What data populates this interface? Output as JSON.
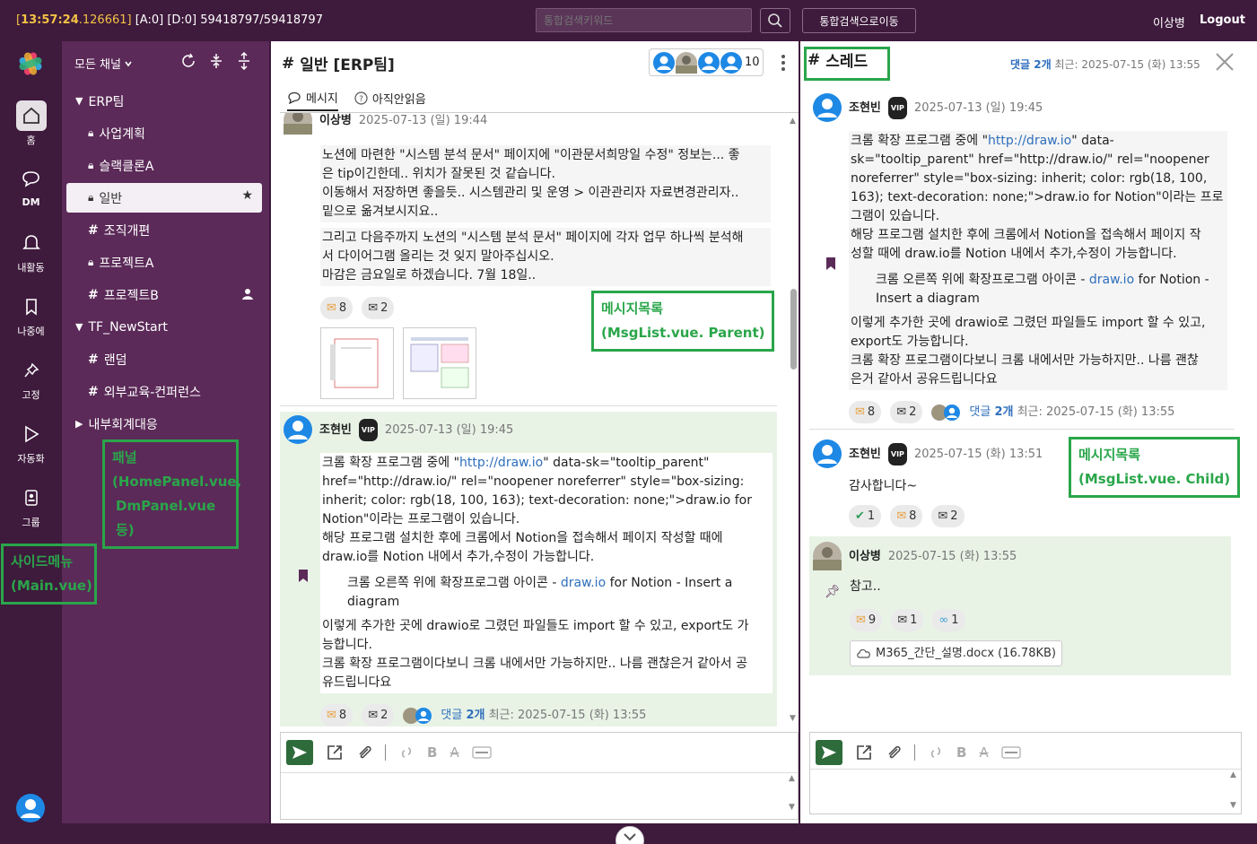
{
  "topbar": {
    "time": "13:57:24",
    "ms": ".126661]",
    "bracket_open": "[",
    "status": " [A:0] [D:0] 59418797/59418797",
    "search_placeholder": "통합검색키워드",
    "move_btn": "통합검색으로이동",
    "user": "이상병",
    "logout": "Logout"
  },
  "sidemenu": {
    "items": [
      {
        "label": "홈",
        "icon": "home-icon"
      },
      {
        "label": "DM",
        "icon": "dm-icon"
      },
      {
        "label": "내활동",
        "icon": "bell-icon"
      },
      {
        "label": "나중에",
        "icon": "bookmark-icon"
      },
      {
        "label": "고정",
        "icon": "pin-icon"
      },
      {
        "label": "자동화",
        "icon": "play-icon"
      },
      {
        "label": "그룹",
        "icon": "group-icon"
      }
    ]
  },
  "panel": {
    "header": "모든 채널",
    "tree": [
      {
        "label": "ERP팀",
        "kind": "group"
      },
      {
        "label": "사업계획",
        "kind": "lock"
      },
      {
        "label": "슬랙클론A",
        "kind": "lock"
      },
      {
        "label": "일반",
        "kind": "lock"
      },
      {
        "label": "조직개편",
        "kind": "hash"
      },
      {
        "label": "프로젝트A",
        "kind": "lock"
      },
      {
        "label": "프로젝트B",
        "kind": "hash"
      },
      {
        "label": "TF_NewStart",
        "kind": "group"
      },
      {
        "label": "랜덤",
        "kind": "hash"
      },
      {
        "label": "외부교육-컨퍼런스",
        "kind": "hash"
      },
      {
        "label": "내부회계대응",
        "kind": "collapsed"
      }
    ]
  },
  "main": {
    "title": "일반 [ERP팀]",
    "member_count": "10",
    "tabs": [
      "메시지",
      "아직안읽음"
    ],
    "msg1": {
      "name": "이상병",
      "date": "2025-07-13 (일) 19:44",
      "lines": [
        "노션에 마련한 \"시스템 분석 문서\" 페이지에 \"이관문서희망일 수정\" 정보는... 좋",
        "은 tip이긴한데.. 위치가 잘못된 것 같습니다.",
        "이동해서 저장하면 좋을듯..  시스템관리 및 운영 > 이관관리자 자료변경관리자..",
        "밑으로 옮겨보시지요..",
        "그리고 다음주까지 노션의 \"시스템 분석 문서\" 페이지에 각자 업무 하나씩 분석해",
        "서 다이어그램 올리는 것 잊지 말아주십시오.",
        "마감은 금요일로 하겠습니다. 7월 18일.."
      ],
      "r1": "8",
      "r2": "2"
    },
    "msg2": {
      "name": "조현빈",
      "vip": "VIP",
      "date": "2025-07-13 (일) 19:45",
      "p1a": "크롬 확장 프로그램 중에 \"",
      "p1link": "http://draw.io",
      "p1b": "\" data-sk=\"tooltip_parent\"",
      "p1c": "href=\"http://draw.io/\" rel=\"noopener noreferrer\" style=\"box-sizing:",
      "p1d": "inherit; color: rgb(18, 100, 163); text-decoration: none;\">draw.io for",
      "p1e": "Notion\"이라는 프로그램이 있습니다.",
      "p2a": "해당 프로그램 설치한 후에 크롬에서 Notion을 접속해서 페이지 작성할 때에",
      "p2b": "draw.io를 Notion 내에서 추가,수정이 가능합니다.",
      "q1a": "크롬 오른쪽 위에 확장프로그램 아이콘 - ",
      "q1link": "draw.io",
      "q1b": " for Notion - Insert a",
      "q1c": "diagram",
      "p3a": "이렇게 추가한 곳에 drawio로 그렸던 파일들도 import 할 수 있고, export도 가",
      "p3b": "능합니다.",
      "p4a": "크롬 확장 프로그램이다보니 크롬 내에서만 가능하지만.. 나름 괜찮은거 같아서 공",
      "p4b": "유드립니다요",
      "r1": "8",
      "r2": "2",
      "reply_pre": "댓글 ",
      "reply_num": "2개",
      "reply_post": " 최근: 2025-07-15 (화) 13:55"
    }
  },
  "labels": {
    "parent1": "메시지목록",
    "parent2": "(MsgList.vue. Parent)",
    "child1": "메시지목록",
    "child2": "(MsgList.vue. Child)",
    "panel1": "패널",
    "panel2": "(HomePanel.vue,",
    "panel3": "DmPanel.vue 등)",
    "side1": "사이드메뉴",
    "side2": "(Main.vue)"
  },
  "thread": {
    "title": "스레드",
    "meta_count": "댓글 2개",
    "meta_recent": " 최근: 2025-07-15 (화) 13:55",
    "t1": {
      "name": "조현빈",
      "vip": "VIP",
      "date": "2025-07-13 (일) 19:45",
      "l1a": "크롬 확장 프로그램 중에 \"",
      "l1link": "http://draw.io",
      "l1b": "\" data-",
      "l2": "sk=\"tooltip_parent\" href=\"http://draw.io/\" rel=\"noopener",
      "l3": "noreferrer\" style=\"box-sizing: inherit; color: rgb(18, 100,",
      "l4": "163); text-decoration: none;\">draw.io for Notion\"이라는 프로",
      "l5": "그램이 있습니다.",
      "l6": "해당 프로그램 설치한 후에 크롬에서 Notion을 접속해서 페이지 작",
      "l7": "성할 때에 draw.io를 Notion 내에서 추가,수정이 가능합니다.",
      "q1a": "크롬 오른쪽 위에 확장프로그램 아이콘 - ",
      "q1link": "draw.io",
      "q1b": " for Notion -",
      "q2": "Insert a diagram",
      "l8": "이렇게 추가한 곳에 drawio로 그렸던 파일들도 import 할 수 있고,",
      "l9": "export도 가능합니다.",
      "l10": "크롬 확장 프로그램이다보니 크롬 내에서만 가능하지만.. 나름 괜찮",
      "l11": "은거 같아서 공유드립니다요",
      "r1": "8",
      "r2": "2",
      "reply_pre": "댓글 ",
      "reply_num": "2개",
      "reply_post": " 최근: 2025-07-15 (화) 13:55"
    },
    "t2": {
      "name": "조현빈",
      "vip": "VIP",
      "date": "2025-07-15 (화) 13:51",
      "text": "감사합니다~",
      "r0": "1",
      "r1": "8",
      "r2": "2"
    },
    "t3": {
      "name": "이상병",
      "date": "2025-07-15 (화) 13:55",
      "text": "참고..",
      "r1": "9",
      "r2": "1",
      "r3": "1",
      "file": "M365_간단_설명.docx (16.78KB)"
    }
  },
  "colors": {
    "sidebar": "#3e1a3c",
    "panel": "#5b2a58",
    "highlight": "#e8f3e6",
    "label_green": "#2aa64a",
    "link": "#2f6fbd",
    "time_yellow": "#f3c344"
  }
}
